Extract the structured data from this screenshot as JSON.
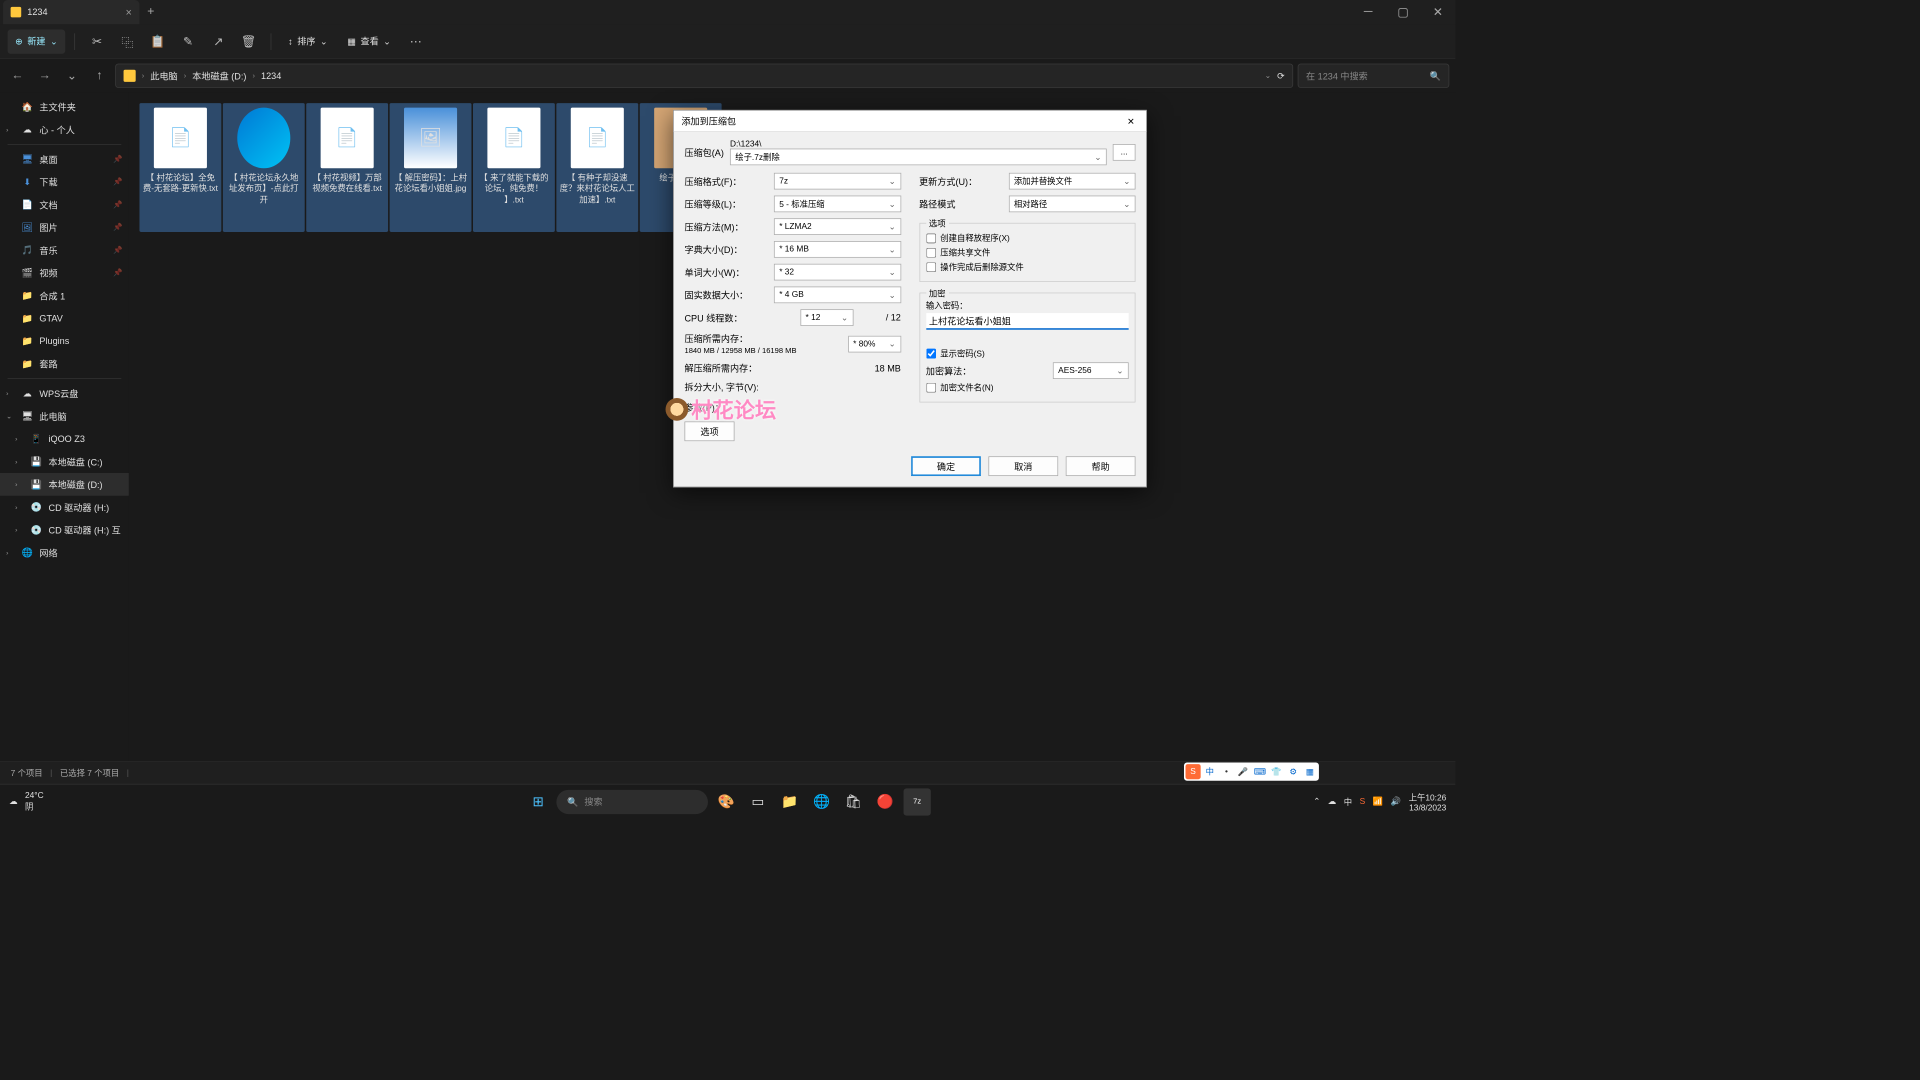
{
  "tab": {
    "title": "1234"
  },
  "toolbar": {
    "new": "新建",
    "sort": "排序",
    "view": "查看"
  },
  "breadcrumb": {
    "pc": "此电脑",
    "drive": "本地磁盘 (D:)",
    "folder": "1234"
  },
  "search": {
    "placeholder": "在 1234 中搜索"
  },
  "sidebar": {
    "home": "主文件夹",
    "personal": "心 - 个人",
    "desktop": "桌面",
    "downloads": "下载",
    "documents": "文档",
    "pictures": "图片",
    "music": "音乐",
    "videos": "视频",
    "f1": "合成 1",
    "f2": "GTAV",
    "f3": "Plugins",
    "f4": "套路",
    "wps": "WPS云盘",
    "thispc": "此电脑",
    "iqoo": "iQOO Z3",
    "cdrive": "本地磁盘 (C:)",
    "ddrive": "本地磁盘 (D:)",
    "cd1": "CD 驱动器 (H:)",
    "cd2": "CD 驱动器 (H:) 互",
    "network": "网络"
  },
  "files": {
    "f1": "【 村花论坛】全免费-无套路-更新快.txt",
    "f2": "【 村花论坛永久地址发布页】-点此打开",
    "f3": "【 村花视频】万部视频免费在线看.txt",
    "f4": "【 解压密码】：上村花论坛看小姐姐.jpg",
    "f5": "【 来了就能下载的论坛，纯免费！ 】.txt",
    "f6": "【 有种子却没速度？来村花论坛人工加速】.txt",
    "f7": "绘子\nSAMA"
  },
  "status": {
    "items": "7 个项目",
    "selected": "已选择 7 个项目"
  },
  "dialog": {
    "title": "添加到压缩包",
    "archive_lbl": "压缩包(A)",
    "archive_path": "D:\\1234\\",
    "archive_name": "绘子.7z删除",
    "browse": "...",
    "format_lbl": "压缩格式(F)：",
    "format": "7z",
    "level_lbl": "压缩等级(L)：",
    "level": "5 - 标准压缩",
    "method_lbl": "压缩方法(M)：",
    "method": "* LZMA2",
    "dict_lbl": "字典大小(D)：",
    "dict": "* 16 MB",
    "word_lbl": "单词大小(W)：",
    "word": "* 32",
    "solid_lbl": "固实数据大小：",
    "solid": "* 4 GB",
    "threads_lbl": "CPU 线程数：",
    "threads": "* 12",
    "threads_max": "/ 12",
    "mem_c_lbl": "压缩所需内存：",
    "mem_c": "1840 MB / 12958 MB / 16198 MB",
    "mem_pct": "* 80%",
    "mem_d_lbl": "解压缩所需内存：",
    "mem_d": "18 MB",
    "split_lbl": "拆分大小, 字节(V):",
    "params_lbl": "参数(P)：",
    "options_btn": "选项",
    "update_lbl": "更新方式(U)：",
    "update": "添加并替换文件",
    "path_lbl": "路径模式",
    "path": "相对路径",
    "opts_grp": "选项",
    "opt_sfx": "创建自释放程序(X)",
    "opt_share": "压缩共享文件",
    "opt_del": "操作完成后删除源文件",
    "enc_grp": "加密",
    "pwd_lbl": "输入密码：",
    "pwd_val": "上村花论坛看小姐姐",
    "show_pwd": "显示密码(S)",
    "enc_method_lbl": "加密算法：",
    "enc_method": "AES-256",
    "enc_names": "加密文件名(N)",
    "ok": "确定",
    "cancel": "取消",
    "help": "帮助"
  },
  "taskbar": {
    "temp": "24°C",
    "weather": "阴",
    "search": "搜索",
    "time": "上午10:26",
    "date": "13/8/2023",
    "lang": "中"
  },
  "watermark": "村花论坛"
}
